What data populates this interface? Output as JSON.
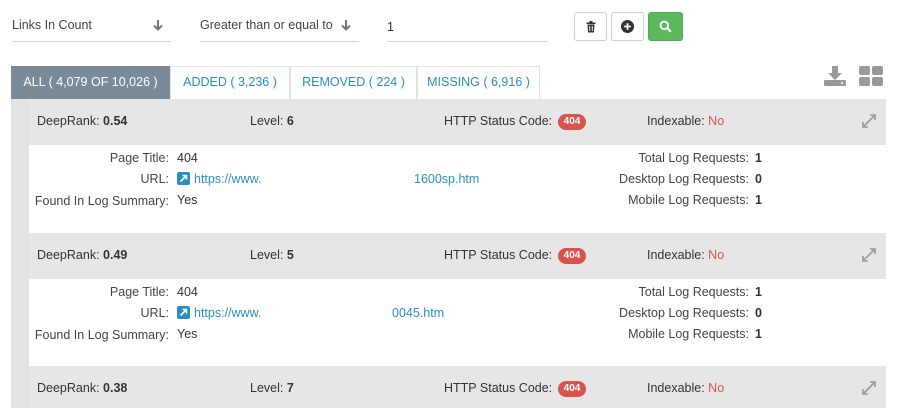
{
  "filter": {
    "field": "Links In Count",
    "operator": "Greater than or equal to",
    "value": "1"
  },
  "colors": {
    "accent": "#2a8fc0",
    "search_button": "#5cb85c",
    "tab_active": "#7a8a99",
    "badge_error": "#d9534f"
  },
  "tabs": [
    {
      "label": "ALL ( 4,079 OF 10,026 )"
    },
    {
      "label": "ADDED ( 3,236 )"
    },
    {
      "label": "REMOVED ( 224 )"
    },
    {
      "label": "MISSING ( 6,916 )"
    }
  ],
  "labels": {
    "deeprank": "DeepRank:",
    "level": "Level:",
    "http_status": "HTTP Status Code:",
    "indexable": "Indexable:",
    "page_title": "Page Title:",
    "url": "URL:",
    "found_in_log_summary": "Found In Log Summary:",
    "total_log_requests": "Total Log Requests:",
    "desktop_log_requests": "Desktop Log Requests:",
    "mobile_log_requests": "Mobile Log Requests:"
  },
  "results": [
    {
      "deeprank": "0.54",
      "level": "6",
      "http_status": "404",
      "indexable": "No",
      "page_title": "404",
      "url_start": "https://www.",
      "url_end": "1600sp.htm",
      "found_in_log_summary": "Yes",
      "total_log_requests": "1",
      "desktop_log_requests": "0",
      "mobile_log_requests": "1"
    },
    {
      "deeprank": "0.49",
      "level": "5",
      "http_status": "404",
      "indexable": "No",
      "page_title": "404",
      "url_start": "https://www.",
      "url_end": "0045.htm",
      "found_in_log_summary": "Yes",
      "total_log_requests": "1",
      "desktop_log_requests": "0",
      "mobile_log_requests": "1"
    },
    {
      "deeprank": "0.38",
      "level": "7",
      "http_status": "404",
      "indexable": "No"
    }
  ]
}
